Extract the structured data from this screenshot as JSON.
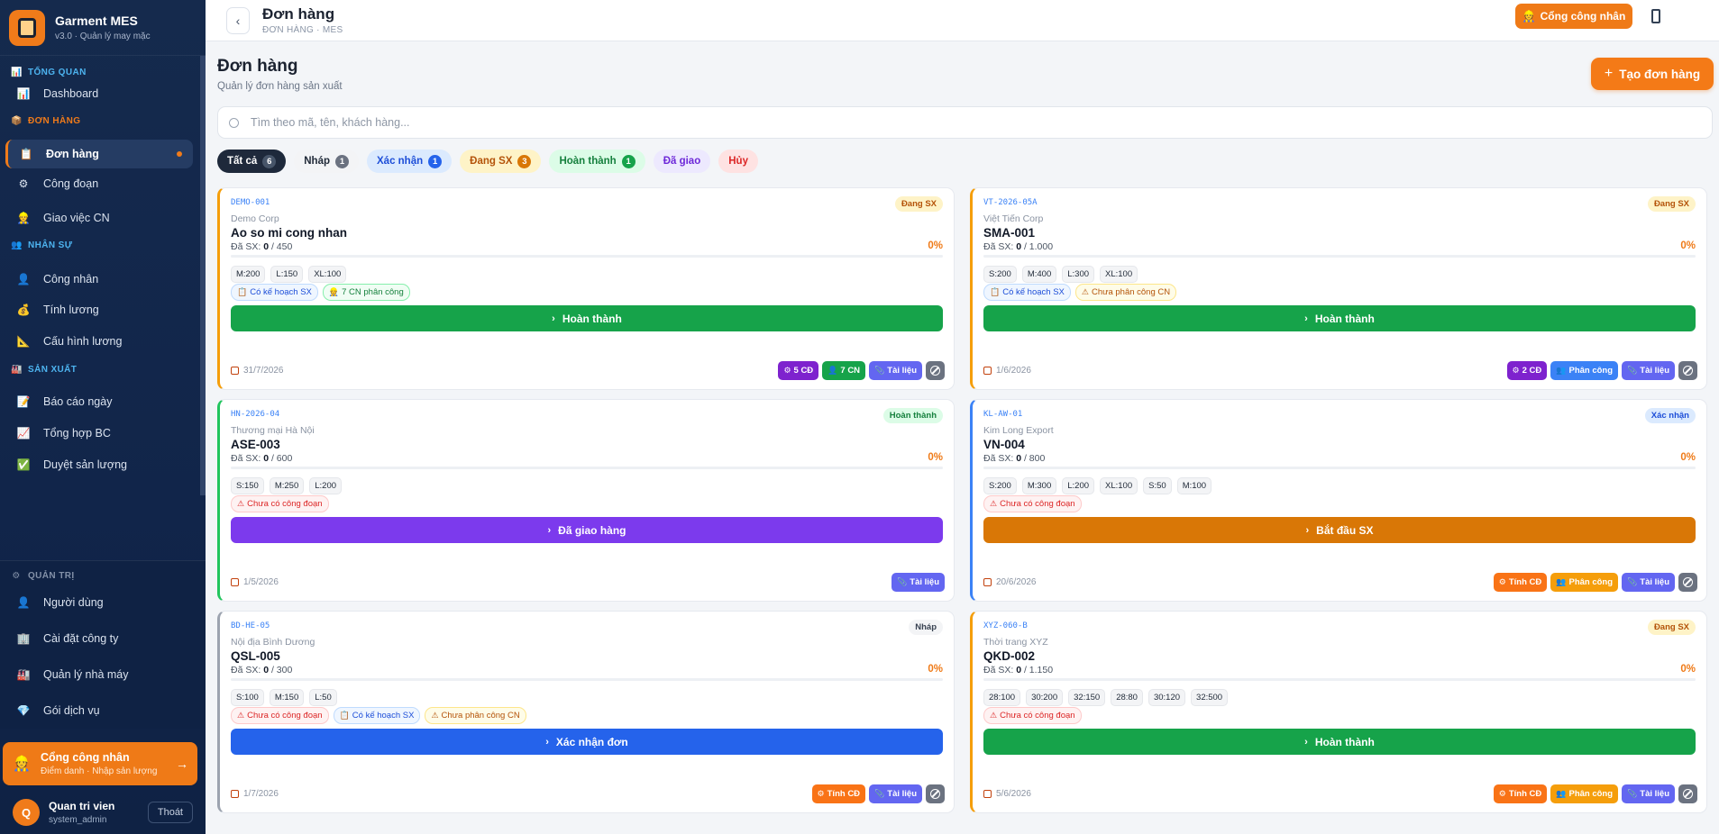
{
  "brand": {
    "title": "Garment MES",
    "subtitle": "v3.0 · Quản lý may mặc"
  },
  "sidebar": {
    "sections": [
      {
        "label": "TỔNG QUAN",
        "icon": "chart-icon",
        "items": [
          {
            "label": "Dashboard",
            "icon": "chart-icon"
          }
        ]
      },
      {
        "label": "ĐƠN HÀNG",
        "icon": "box-icon",
        "items": [
          {
            "label": "Đơn hàng",
            "icon": "clipboard-icon",
            "active": true
          },
          {
            "label": "Công đoạn",
            "icon": "gear-icon"
          },
          {
            "label": "Giao việc CN",
            "icon": "worker-icon"
          }
        ]
      },
      {
        "label": "NHÂN SỰ",
        "icon": "people-icon",
        "items": [
          {
            "label": "Công nhân",
            "icon": "person-icon"
          },
          {
            "label": "Tính lương",
            "icon": "money-bag-icon"
          },
          {
            "label": "Cấu hình lương",
            "icon": "ruler-icon"
          }
        ]
      },
      {
        "label": "SẢN XUẤT",
        "icon": "factory-icon",
        "items": [
          {
            "label": "Báo cáo ngày",
            "icon": "report-icon"
          },
          {
            "label": "Tổng hợp BC",
            "icon": "trend-icon"
          },
          {
            "label": "Duyệt sản lượng",
            "icon": "check-icon"
          }
        ]
      }
    ],
    "admin": {
      "label": "QUẢN TRỊ",
      "icon": "gear-icon",
      "items": [
        {
          "label": "Người dùng",
          "icon": "person-icon"
        },
        {
          "label": "Cài đặt công ty",
          "icon": "building-icon"
        },
        {
          "label": "Quản lý nhà máy",
          "icon": "factory-icon"
        },
        {
          "label": "Gói dịch vụ",
          "icon": "gem-icon"
        }
      ]
    },
    "portal": {
      "title": "Cổng công nhân",
      "subtitle": "Điểm danh · Nhập sản lượng",
      "arrow": "→"
    },
    "user": {
      "initial": "Q",
      "name": "Quan tri vien",
      "role": "system_admin",
      "logout": "Thoát"
    }
  },
  "topbar": {
    "back": "‹",
    "title": "Đơn hàng",
    "subtitle": "ĐƠN HÀNG · MES",
    "portal_button": "Cổng công nhân"
  },
  "page": {
    "title": "Đơn hàng",
    "subtitle": "Quản lý đơn hàng sản xuất",
    "create_button": "Tạo đơn hàng",
    "search_placeholder": "Tìm theo mã, tên, khách hàng..."
  },
  "filters": [
    {
      "label": "Tất cả",
      "count": "6",
      "bg": "#1e293b",
      "fg": "#ffffff",
      "cbg": "#475569",
      "cfg": "#ffffff"
    },
    {
      "label": "Nháp",
      "count": "1",
      "bg": "#f3f4f6",
      "fg": "#1f2937",
      "cbg": "#6b7280",
      "cfg": "#ffffff"
    },
    {
      "label": "Xác nhận",
      "count": "1",
      "bg": "#dbeafe",
      "fg": "#1d4ed8",
      "cbg": "#2563eb",
      "cfg": "#ffffff"
    },
    {
      "label": "Đang SX",
      "count": "3",
      "bg": "#fef3c7",
      "fg": "#b45309",
      "cbg": "#d97706",
      "cfg": "#ffffff"
    },
    {
      "label": "Hoàn thành",
      "count": "1",
      "bg": "#dcfce7",
      "fg": "#15803d",
      "cbg": "#16a34a",
      "cfg": "#ffffff"
    },
    {
      "label": "Đã giao",
      "count": "",
      "bg": "#ede9fe",
      "fg": "#6d28d9",
      "cbg": "",
      "cfg": ""
    },
    {
      "label": "Hủy",
      "count": "",
      "bg": "#fee2e2",
      "fg": "#dc2626",
      "cbg": "",
      "cfg": ""
    }
  ],
  "orders": [
    {
      "code": "DEMO-001",
      "status": "Đang SX",
      "status_bg": "#fef3c7",
      "status_fg": "#b45309",
      "accent": "#f59e0b",
      "customer": "Demo Corp",
      "product": "Ao so mi cong nhan",
      "progress_label": "Đã SX:",
      "produced": "0",
      "total": "/ 450",
      "percent": "0%",
      "progress": 0,
      "sizes": [
        "M:200",
        "L:150",
        "XL:100"
      ],
      "tags": [
        {
          "text": "Có kế hoạch SX",
          "icon": "📋",
          "kind": "blue"
        },
        {
          "text": "7 CN phân công",
          "icon": "👷",
          "kind": "green"
        }
      ],
      "action": {
        "label": "Hoàn thành",
        "color": "#16a34a"
      },
      "date": "31/7/2026",
      "buttons": [
        {
          "label": "5 CĐ",
          "icon": "⚙",
          "color": "#7e22ce"
        },
        {
          "label": "7 CN",
          "icon": "👤",
          "color": "#16a34a"
        },
        {
          "label": "Tài liệu",
          "icon": "📎",
          "color": "#6366f1"
        },
        {
          "label": "",
          "icon": "ban",
          "color": "#6b7280"
        }
      ]
    },
    {
      "code": "VT-2026-05A",
      "status": "Đang SX",
      "status_bg": "#fef3c7",
      "status_fg": "#b45309",
      "accent": "#f59e0b",
      "customer": "Việt Tiến Corp",
      "product": "SMA-001",
      "progress_label": "Đã SX:",
      "produced": "0",
      "total": "/ 1.000",
      "percent": "0%",
      "progress": 0,
      "sizes": [
        "S:200",
        "M:400",
        "L:300",
        "XL:100"
      ],
      "tags": [
        {
          "text": "Có kế hoạch SX",
          "icon": "📋",
          "kind": "blue"
        },
        {
          "text": "Chưa phân công CN",
          "icon": "⚠",
          "kind": "yellow"
        }
      ],
      "action": {
        "label": "Hoàn thành",
        "color": "#16a34a"
      },
      "date": "1/6/2026",
      "buttons": [
        {
          "label": "2 CĐ",
          "icon": "⚙",
          "color": "#7e22ce"
        },
        {
          "label": "Phân công",
          "icon": "👥",
          "color": "#3b82f6"
        },
        {
          "label": "Tài liệu",
          "icon": "📎",
          "color": "#6366f1"
        },
        {
          "label": "",
          "icon": "ban",
          "color": "#6b7280"
        }
      ]
    },
    {
      "code": "HN-2026-04",
      "status": "Hoàn thành",
      "status_bg": "#dcfce7",
      "status_fg": "#15803d",
      "accent": "#22c55e",
      "customer": "Thương mại Hà Nội",
      "product": "ASE-003",
      "progress_label": "Đã SX:",
      "produced": "0",
      "total": "/ 600",
      "percent": "0%",
      "progress": 0,
      "sizes": [
        "S:150",
        "M:250",
        "L:200"
      ],
      "tags": [
        {
          "text": "Chưa có công đoạn",
          "icon": "⚠",
          "kind": "red"
        }
      ],
      "action": {
        "label": "Đã giao hàng",
        "color": "#7c3aed"
      },
      "date": "1/5/2026",
      "buttons": [
        {
          "label": "Tài liệu",
          "icon": "📎",
          "color": "#6366f1"
        }
      ]
    },
    {
      "code": "KL-AW-01",
      "status": "Xác nhận",
      "status_bg": "#dbeafe",
      "status_fg": "#1d4ed8",
      "accent": "#3b82f6",
      "customer": "Kim Long Export",
      "product": "VN-004",
      "progress_label": "Đã SX:",
      "produced": "0",
      "total": "/ 800",
      "percent": "0%",
      "progress": 0,
      "sizes": [
        "S:200",
        "M:300",
        "L:200",
        "XL:100",
        "S:50",
        "M:100"
      ],
      "tags": [
        {
          "text": "Chưa có công đoạn",
          "icon": "⚠",
          "kind": "red"
        }
      ],
      "action": {
        "label": "Bắt đầu SX",
        "color": "#d97706"
      },
      "date": "20/6/2026",
      "buttons": [
        {
          "label": "Tính CĐ",
          "icon": "⚙",
          "color": "#f97316"
        },
        {
          "label": "Phân công",
          "icon": "👥",
          "color": "#f59e0b"
        },
        {
          "label": "Tài liệu",
          "icon": "📎",
          "color": "#6366f1"
        },
        {
          "label": "",
          "icon": "ban",
          "color": "#6b7280"
        }
      ]
    },
    {
      "code": "BD-HE-05",
      "status": "Nháp",
      "status_bg": "#f3f4f6",
      "status_fg": "#374151",
      "accent": "#9ca3af",
      "customer": "Nội địa Bình Dương",
      "product": "QSL-005",
      "progress_label": "Đã SX:",
      "produced": "0",
      "total": "/ 300",
      "percent": "0%",
      "progress": 0,
      "sizes": [
        "S:100",
        "M:150",
        "L:50"
      ],
      "tags": [
        {
          "text": "Chưa có công đoạn",
          "icon": "⚠",
          "kind": "red"
        },
        {
          "text": "Có kế hoạch SX",
          "icon": "📋",
          "kind": "blue"
        },
        {
          "text": "Chưa phân công CN",
          "icon": "⚠",
          "kind": "yellow"
        }
      ],
      "action": {
        "label": "Xác nhận đơn",
        "color": "#2563eb"
      },
      "date": "1/7/2026",
      "buttons": [
        {
          "label": "Tính CĐ",
          "icon": "⚙",
          "color": "#f97316"
        },
        {
          "label": "Tài liệu",
          "icon": "📎",
          "color": "#6366f1"
        },
        {
          "label": "",
          "icon": "ban",
          "color": "#6b7280"
        }
      ]
    },
    {
      "code": "XYZ-060-B",
      "status": "Đang SX",
      "status_bg": "#fef3c7",
      "status_fg": "#b45309",
      "accent": "#f59e0b",
      "customer": "Thời trang XYZ",
      "product": "QKD-002",
      "progress_label": "Đã SX:",
      "produced": "0",
      "total": "/ 1.150",
      "percent": "0%",
      "progress": 0,
      "sizes": [
        "28:100",
        "30:200",
        "32:150",
        "28:80",
        "30:120",
        "32:500"
      ],
      "tags": [
        {
          "text": "Chưa có công đoạn",
          "icon": "⚠",
          "kind": "red"
        }
      ],
      "action": {
        "label": "Hoàn thành",
        "color": "#16a34a"
      },
      "date": "5/6/2026",
      "buttons": [
        {
          "label": "Tính CĐ",
          "icon": "⚙",
          "color": "#f97316"
        },
        {
          "label": "Phân công",
          "icon": "👥",
          "color": "#f59e0b"
        },
        {
          "label": "Tài liệu",
          "icon": "📎",
          "color": "#6366f1"
        },
        {
          "label": "",
          "icon": "ban",
          "color": "#6b7280"
        }
      ]
    }
  ]
}
